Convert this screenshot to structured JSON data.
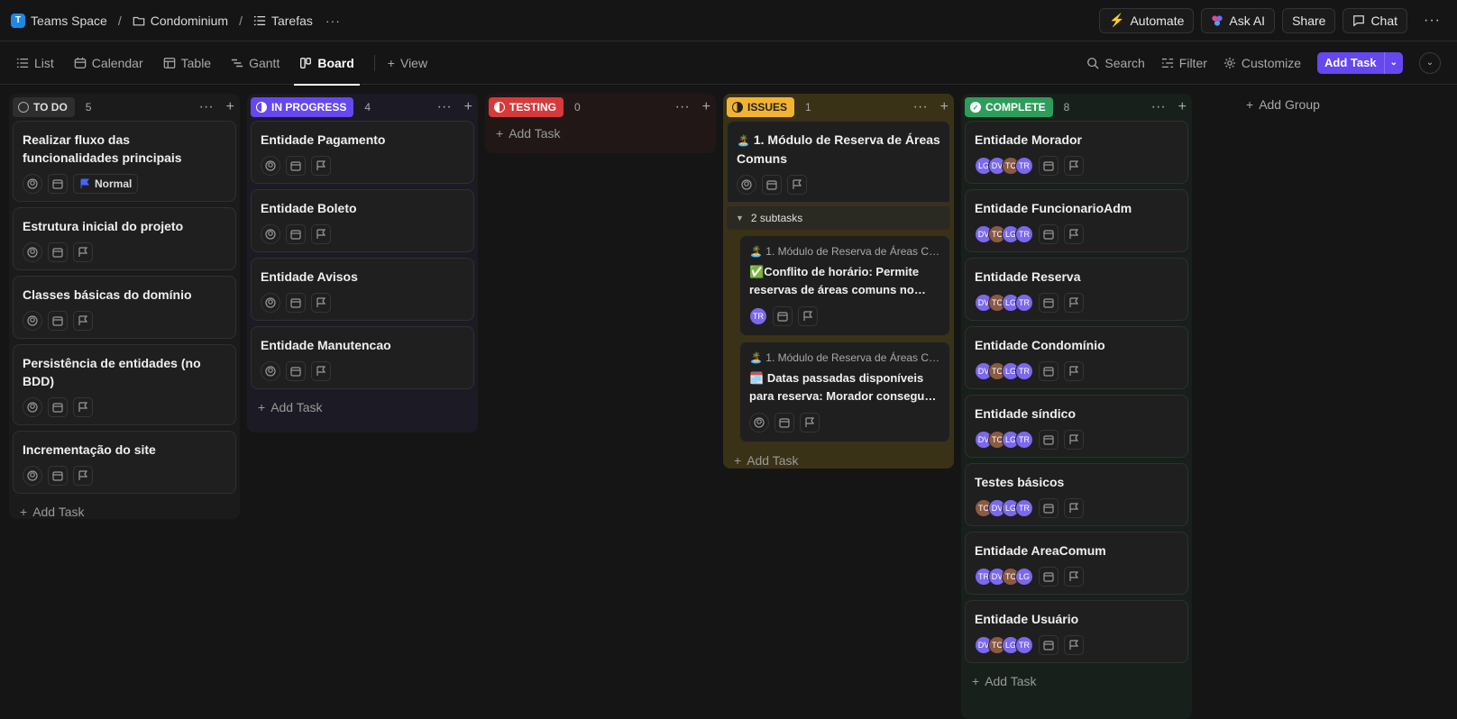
{
  "breadcrumb": {
    "space": "Teams Space",
    "space_initial": "T",
    "folder": "Condominium",
    "list": "Tarefas"
  },
  "top_actions": {
    "automate": "Automate",
    "ask_ai": "Ask AI",
    "share": "Share",
    "chat": "Chat"
  },
  "views": {
    "list": "List",
    "calendar": "Calendar",
    "table": "Table",
    "gantt": "Gantt",
    "board": "Board",
    "add_view": "View"
  },
  "toolbar": {
    "search": "Search",
    "filter": "Filter",
    "customize": "Customize",
    "add_task": "Add Task"
  },
  "add_task_label": "Add Task",
  "add_group_label": "Add Group",
  "columns": {
    "todo": {
      "label": "TO DO",
      "count": "5",
      "color": "#3a3a3a",
      "cards": [
        {
          "title": "Realizar fluxo das funcionalidades principais",
          "priority": "Normal"
        },
        {
          "title": "Estrutura inicial do projeto"
        },
        {
          "title": "Classes básicas do domínio"
        },
        {
          "title": "Persistência de entidades (no BDD)"
        },
        {
          "title": "Incrementação do site"
        }
      ]
    },
    "in_progress": {
      "label": "IN PROGRESS",
      "count": "4",
      "color": "#6647f0",
      "cards": [
        {
          "title": "Entidade Pagamento"
        },
        {
          "title": "Entidade Boleto"
        },
        {
          "title": "Entidade Avisos"
        },
        {
          "title": "Entidade Manutencao"
        }
      ]
    },
    "testing": {
      "label": "TESTING",
      "count": "0",
      "color": "#d63a3a"
    },
    "issues": {
      "label": "ISSUES",
      "count": "1",
      "color": "#f2b430",
      "card": {
        "title": "1. Módulo de Reserva de Áreas Comuns",
        "emoji": "🏝️"
      },
      "subtasks_label": "2 subtasks",
      "subtasks": [
        {
          "parent": "1. Módulo de Reserva de Áreas Co...",
          "emoji": "✅",
          "title": "Conflito de horário: Permite reservas de áreas comuns no mesmo horário",
          "assignee": "TR"
        },
        {
          "parent": "1. Módulo de Reserva de Áreas Co...",
          "emoji": "🗓️",
          "title": "Datas passadas disponíveis para reserva: Morador consegue reservar datas passadas"
        }
      ]
    },
    "complete": {
      "label": "COMPLETE",
      "count": "8",
      "color": "#2e9d5b",
      "cards": [
        {
          "title": "Entidade Morador",
          "assignees": [
            "LG",
            "DV",
            "TC",
            "TR"
          ]
        },
        {
          "title": "Entidade FuncionarioAdm",
          "assignees": [
            "DV",
            "TC",
            "LG",
            "TR"
          ]
        },
        {
          "title": "Entidade Reserva",
          "assignees": [
            "DV",
            "TC",
            "LG",
            "TR"
          ]
        },
        {
          "title": "Entidade Condomínio",
          "assignees": [
            "DV",
            "TC",
            "LG",
            "TR"
          ]
        },
        {
          "title": "Entidade síndico",
          "assignees": [
            "DV",
            "TC",
            "LG",
            "TR"
          ]
        },
        {
          "title": "Testes básicos",
          "assignees": [
            "TC",
            "DV",
            "LG",
            "TR"
          ]
        },
        {
          "title": "Entidade AreaComum",
          "assignees": [
            "TR",
            "DV",
            "TC",
            "LG"
          ]
        },
        {
          "title": "Entidade Usuário",
          "assignees": [
            "DV",
            "TC",
            "LG",
            "TR"
          ]
        }
      ]
    }
  },
  "avatar_colors": {
    "LG": "#7b68ee",
    "DV": "#7b68ee",
    "TC": "#8a5a44",
    "TR": "#7b68ee"
  }
}
